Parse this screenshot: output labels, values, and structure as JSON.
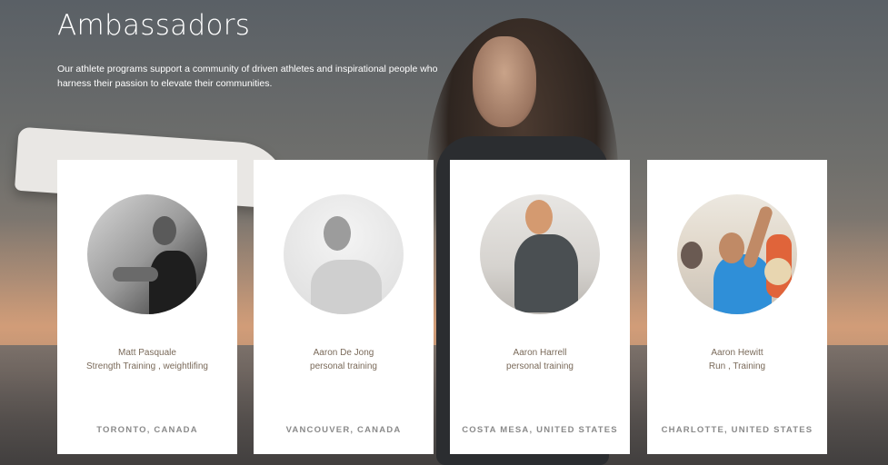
{
  "page": {
    "title": "Ambassadors",
    "intro": "Our athlete programs support a community of driven athletes and inspirational people who harness their passion to elevate their communities."
  },
  "ambassadors": [
    {
      "name": "Matt  Pasquale",
      "sport": "Strength Training , weightlifing",
      "location": "TORONTO, CANADA",
      "photo_icon": "athlete-photo"
    },
    {
      "name": "Aaron De Jong",
      "sport": "personal training",
      "location": "VANCOUVER, CANADA",
      "photo_icon": "athlete-photo"
    },
    {
      "name": "Aaron Harrell",
      "sport": "personal training",
      "location": "COSTA MESA, UNITED STATES",
      "photo_icon": "athlete-photo"
    },
    {
      "name": "Aaron Hewitt",
      "sport": "Run , Training",
      "location": "CHARLOTTE, UNITED STATES",
      "photo_icon": "athlete-photo"
    }
  ],
  "colors": {
    "card_text": "#7a6a5a",
    "location_text": "#8a8a8a",
    "card_bg": "#ffffff"
  }
}
